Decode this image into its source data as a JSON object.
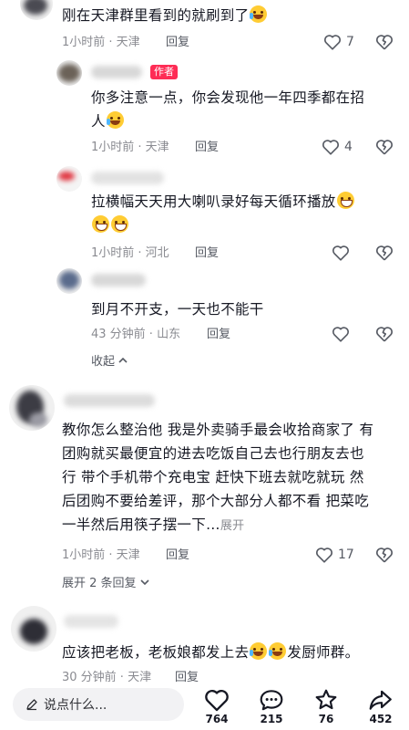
{
  "comments": [
    {
      "text": "刚在天津群里看到的就刷到了",
      "time": "1小时前 · 天津",
      "reply": "回复",
      "likes": "7"
    },
    {
      "author_tag": "作者",
      "text_line1": "你多注意一点，你会发现他一年四季都在招",
      "text_line2": "人",
      "time": "1小时前 · 天津",
      "reply": "回复",
      "likes": "4"
    },
    {
      "text_line1": "拉横幅天天用大喇叭录好每天循环播放",
      "time": "1小时前 · 河北",
      "reply": "回复"
    },
    {
      "text": "到月不开支，一天也不能干",
      "time": "43 分钟前 · 山东",
      "reply": "回复",
      "collapse": "收起"
    },
    {
      "text_line1": "教你怎么整治他 我是外卖骑手最会收拾商家了 有",
      "text_line2": "团购就买最便宜的进去吃饭自己去也行朋友去也",
      "text_line3": "行 带个手机带个充电宝 赶快下班去就吃就玩 然",
      "text_line4": "后团购不要给差评，那个大部分人都不看 把菜吃",
      "text_line5": "一半然后用筷子摆一下…",
      "more": "展开",
      "time": "1小时前 · 天津",
      "reply": "回复",
      "likes": "17",
      "expand": "展开 2 条回复"
    },
    {
      "text_a": "应该把老板，老板娘都发上去",
      "text_b": "发厨师群。",
      "time": "30 分钟前 · 天津",
      "reply": "回复"
    }
  ],
  "bottom_bar": {
    "placeholder": "说点什么...",
    "likes": "764",
    "comments": "215",
    "favorites": "76",
    "shares": "452"
  },
  "colors": {
    "author_tag": "#fe2c55",
    "meta": "#8a8b91",
    "text": "#161823"
  }
}
